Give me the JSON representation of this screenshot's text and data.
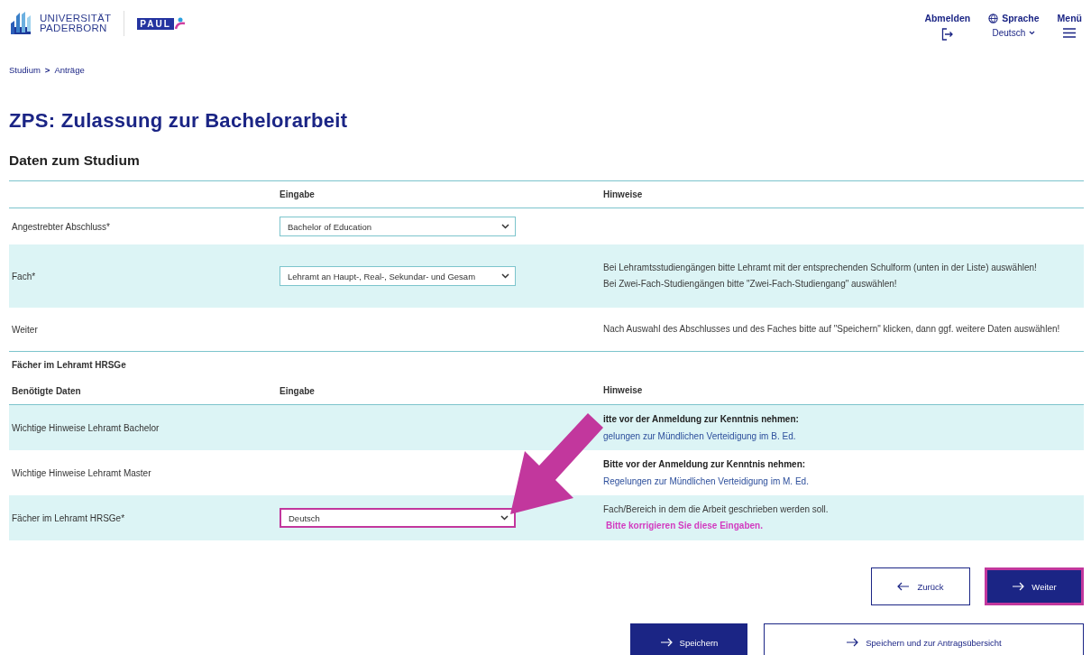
{
  "header": {
    "logo": {
      "line_1": "UNIVERSITÄT",
      "line_2": "PADERBORN",
      "badge": "PAUL"
    },
    "nav": [
      {
        "kind": "logout",
        "label": "Abmelden"
      },
      {
        "kind": "language",
        "label": "Sprache",
        "value": "Deutsch"
      },
      {
        "kind": "menu",
        "label": "Menü"
      }
    ]
  },
  "breadcrumb": [
    {
      "label": "Studium"
    },
    {
      "label": ">"
    },
    {
      "label": "Anträge"
    }
  ],
  "title": "ZPS: Zulassung zur Bachelorarbeit",
  "section": "Daten zum Studium",
  "table_1": {
    "columns": [
      "Eingabe",
      "Hinweise"
    ],
    "rows": [
      {
        "label": "Angestrebter Abschluss*",
        "select": {
          "value": "Bachelor of Education",
          "error": false
        },
        "hints": []
      },
      {
        "label": "Fach*",
        "select": {
          "value": "Lehramt an Haupt-, Real-, Sekundar- und Gesam",
          "error": false
        },
        "hints": [
          {
            "kind": "text",
            "text": "Bei Lehramtsstudiengängen bitte Lehramt mit der entsprechenden Schulform (unten in der Liste) auswählen!"
          },
          {
            "kind": "text",
            "text": "Bei Zwei-Fach-Studiengängen bitte \"Zwei-Fach-Studiengang\" auswählen!"
          }
        ]
      },
      {
        "label": "Weiter",
        "hints": [
          {
            "kind": "text",
            "text": "Nach Auswahl des Abschlusses und des Faches bitte auf \"Speichern\" klicken, dann ggf. weitere Daten auswählen!"
          }
        ]
      }
    ]
  },
  "subsection": "Fächer im Lehramt HRSGe",
  "table_2": {
    "columns": [
      "Benötigte Daten",
      "Eingabe",
      "Hinweise"
    ],
    "rows": [
      {
        "label": "Wichtige Hinweise Lehramt Bachelor",
        "hints": [
          {
            "kind": "bold",
            "text": "itte vor der Anmeldung zur Kenntnis nehmen:"
          },
          {
            "kind": "link",
            "text": "gelungen zur Mündlichen Verteidigung im B. Ed."
          }
        ]
      },
      {
        "label": "Wichtige Hinweise Lehramt Master",
        "hints": [
          {
            "kind": "bold",
            "text": "Bitte vor der Anmeldung zur Kenntnis nehmen:"
          },
          {
            "kind": "link",
            "text": "Regelungen zur Mündlichen Verteidigung im M. Ed."
          }
        ]
      },
      {
        "label": "Fächer im Lehramt HRSGe*",
        "select": {
          "value": "Deutsch",
          "error": true
        },
        "hints": [
          {
            "kind": "text",
            "text": "Fach/Bereich in dem die Arbeit geschrieben werden soll."
          },
          {
            "kind": "error",
            "text": "Bitte korrigieren Sie diese Eingaben."
          }
        ]
      }
    ]
  },
  "nav_buttons": [
    {
      "label": "Zurück",
      "kind": "back",
      "primary": false,
      "highlighted": false
    },
    {
      "label": "Weiter",
      "kind": "forward",
      "primary": true,
      "highlighted": true
    }
  ],
  "save_buttons": [
    {
      "label": "Speichern",
      "kind": "forward",
      "primary": true,
      "highlighted": false
    },
    {
      "label": "Speichern und zur Antragsübersicht",
      "kind": "forward",
      "primary": false,
      "highlighted": false
    }
  ]
}
